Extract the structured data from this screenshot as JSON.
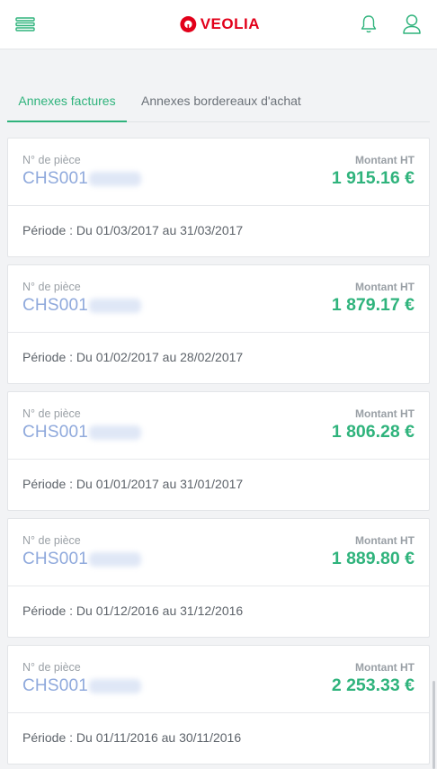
{
  "header": {
    "menu_icon": "hamburger-menu-icon",
    "logo_text": "VEOLIA",
    "logo_color": "#e2001a",
    "notification_icon": "bell-icon",
    "account_icon": "user-icon"
  },
  "tabs": [
    {
      "label": "Annexes factures",
      "active": true
    },
    {
      "label": "Annexes bordereaux d'achat",
      "active": false
    }
  ],
  "labels": {
    "piece": "N° de pièce",
    "amount": "Montant HT"
  },
  "cards": [
    {
      "piece": "CHS001",
      "amount": "1 915.16 €",
      "period": "Période : Du 01/03/2017 au 31/03/2017"
    },
    {
      "piece": "CHS001",
      "amount": "1 879.17 €",
      "period": "Période : Du 01/02/2017 au 28/02/2017"
    },
    {
      "piece": "CHS001",
      "amount": "1 806.28 €",
      "period": "Période : Du 01/01/2017 au 31/01/2017"
    },
    {
      "piece": "CHS001",
      "amount": "1 889.80 €",
      "period": "Période : Du 01/12/2016 au 31/12/2016"
    },
    {
      "piece": "CHS001",
      "amount": "2 253.33 €",
      "period": "Période : Du 01/11/2016 au 30/11/2016"
    }
  ],
  "colors": {
    "accent": "#2fb37c",
    "link": "#8fa9dc",
    "background": "#f2f3f5"
  }
}
